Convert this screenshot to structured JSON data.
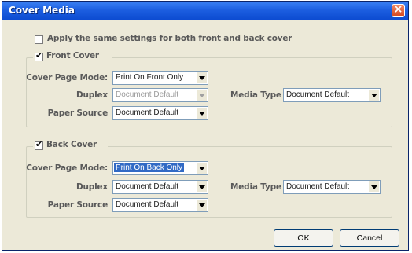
{
  "dialog": {
    "title": "Cover Media"
  },
  "apply_same": {
    "label": "Apply the same settings for both front and back cover",
    "checked": false
  },
  "front_cover": {
    "label": "Front Cover",
    "checked": true,
    "cover_page_mode_label": "Cover Page Mode:",
    "cover_page_mode_value": "Print On Front Only",
    "duplex_label": "Duplex",
    "duplex_value": "Document Default",
    "paper_source_label": "Paper Source",
    "paper_source_value": "Document Default",
    "media_type_label": "Media Type",
    "media_type_value": "Document Default"
  },
  "back_cover": {
    "label": "Back Cover",
    "checked": true,
    "cover_page_mode_label": "Cover Page Mode:",
    "cover_page_mode_value": "Print On Back Only",
    "duplex_label": "Duplex",
    "duplex_value": "Document Default",
    "paper_source_label": "Paper Source",
    "paper_source_value": "Document Default",
    "media_type_label": "Media Type",
    "media_type_value": "Document Default"
  },
  "buttons": {
    "ok_label": "OK",
    "cancel_label": "Cancel"
  },
  "icons": {
    "close": "close-icon",
    "checkbox_mark": "✔",
    "dropdown": "chevron-down-icon"
  },
  "colors": {
    "title_bar": "#0b4ad0",
    "dialog_bg": "#ece9d8",
    "selection": "#316ac5",
    "close_button": "#d4461e"
  }
}
